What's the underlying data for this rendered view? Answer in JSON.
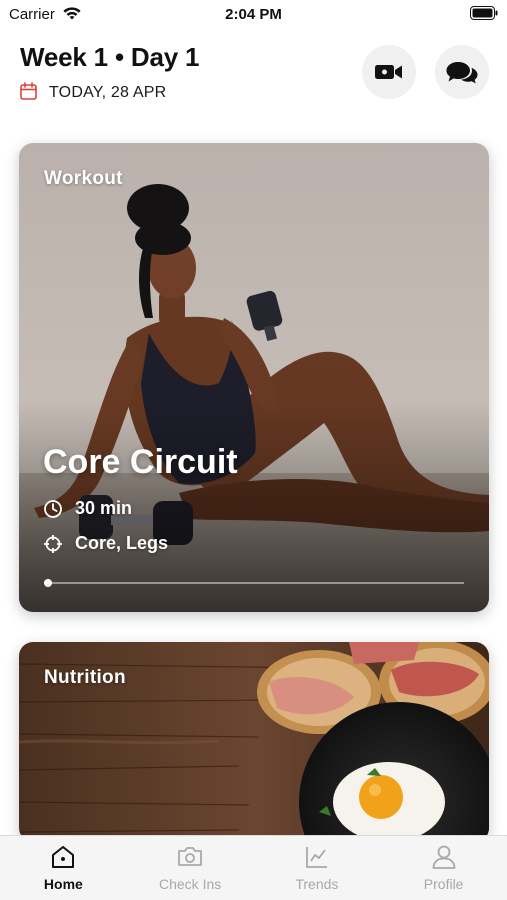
{
  "status_bar": {
    "carrier": "Carrier",
    "time": "2:04 PM"
  },
  "header": {
    "title": "Week 1 • Day 1",
    "date": "TODAY, 28 APR"
  },
  "header_buttons": [
    {
      "icon": "video-camera-icon"
    },
    {
      "icon": "chat-bubbles-icon"
    }
  ],
  "workout_card": {
    "label": "Workout",
    "title": "Core Circuit",
    "duration": "30 min",
    "target": "Core, Legs",
    "progress": 0.01
  },
  "nutrition_card": {
    "label": "Nutrition"
  },
  "tabs": [
    {
      "label": "Home",
      "icon": "home-icon",
      "active": true
    },
    {
      "label": "Check Ins",
      "icon": "camera-icon",
      "active": false
    },
    {
      "label": "Trends",
      "icon": "trend-chart-icon",
      "active": false
    },
    {
      "label": "Profile",
      "icon": "person-icon",
      "active": false
    }
  ],
  "colors": {
    "accent": "#e0403a",
    "active_tab": "#111111",
    "inactive_tab": "#a8a8a8"
  }
}
